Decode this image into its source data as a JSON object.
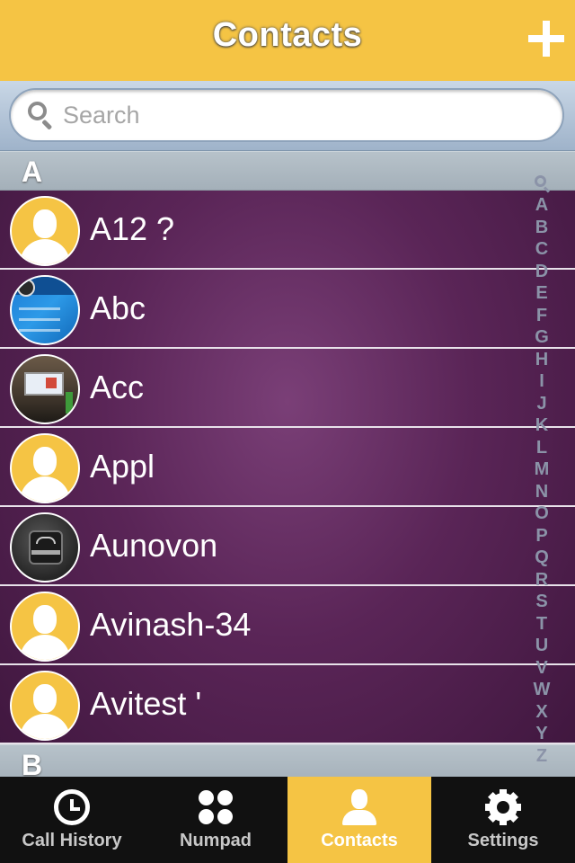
{
  "header": {
    "title": "Contacts",
    "add_icon": "plus-icon"
  },
  "search": {
    "placeholder": "Search",
    "value": "",
    "icon": "search-icon"
  },
  "sections": [
    {
      "letter": "A",
      "contacts": [
        {
          "name": "A12 ?",
          "avatar": "default-avatar"
        },
        {
          "name": "Abc",
          "avatar": "photo-avatar"
        },
        {
          "name": "Acc",
          "avatar": "photo-avatar"
        },
        {
          "name": "Appl",
          "avatar": "default-avatar"
        },
        {
          "name": "Aunovon",
          "avatar": "photo-avatar"
        },
        {
          "name": "Avinash-34",
          "avatar": "default-avatar"
        },
        {
          "name": "Avitest '",
          "avatar": "default-avatar"
        }
      ]
    },
    {
      "letter": "B",
      "contacts": []
    }
  ],
  "index": {
    "search_icon": "search-icon",
    "letters": [
      "A",
      "B",
      "C",
      "D",
      "E",
      "F",
      "G",
      "H",
      "I",
      "J",
      "K",
      "L",
      "M",
      "N",
      "O",
      "P",
      "Q",
      "R",
      "S",
      "T",
      "U",
      "V",
      "W",
      "X",
      "Y",
      "Z"
    ]
  },
  "tabbar": {
    "active": "Contacts",
    "tabs": [
      {
        "label": "Call History",
        "icon": "clock-icon"
      },
      {
        "label": "Numpad",
        "icon": "numpad-icon"
      },
      {
        "label": "Contacts",
        "icon": "person-icon"
      },
      {
        "label": "Settings",
        "icon": "gear-icon"
      }
    ]
  },
  "colors": {
    "accent": "#f5c444",
    "list_background": "#5a2557",
    "tabbar": "#111111"
  }
}
